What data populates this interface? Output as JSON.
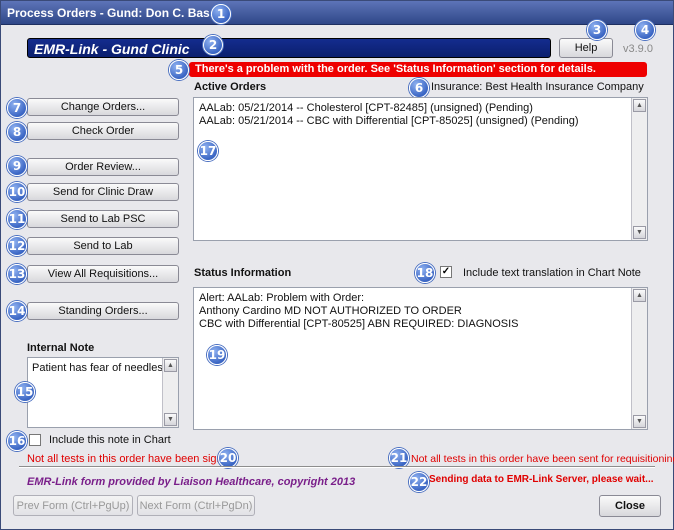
{
  "window": {
    "title": "Process Orders - Gund:  Don C. Bassett"
  },
  "header": {
    "banner": "EMR-Link - Gund Clinic",
    "help_label": "Help",
    "version": "v3.9.0",
    "error_message": "There's a problem with the order. See 'Status Information' section for details."
  },
  "badges": [
    "1",
    "2",
    "3",
    "4",
    "5",
    "6",
    "7",
    "8",
    "9",
    "10",
    "11",
    "12",
    "13",
    "14",
    "15",
    "16",
    "17",
    "18",
    "19",
    "20",
    "21",
    "22"
  ],
  "sidebar": {
    "buttons": [
      {
        "label": "Change Orders..."
      },
      {
        "label": "Check Order"
      },
      {
        "label": "Order Review..."
      },
      {
        "label": "Send for Clinic Draw"
      },
      {
        "label": "Send to Lab PSC"
      },
      {
        "label": "Send to Lab"
      },
      {
        "label": "View All Requisitions..."
      },
      {
        "label": "Standing Orders..."
      }
    ],
    "internal_note": {
      "heading": "Internal Note",
      "value": "Patient has fear of needles",
      "include_label": "Include this note in Chart",
      "include_checked": false
    }
  },
  "active_orders": {
    "heading": "Active Orders",
    "insurance": "Insurance: Best Health Insurance Company",
    "items": [
      "AALab: 05/21/2014 -- Cholesterol [CPT-82485]  (unsigned)   (Pending)",
      "AALab: 05/21/2014 -- CBC with Differential [CPT-85025]  (unsigned)   (Pending)"
    ]
  },
  "status_info": {
    "heading": "Status Information",
    "translate_label": "Include text translation in Chart Note",
    "translate_checked": true,
    "lines": [
      "Alert: AALab: Problem with Order:",
      "Anthony Cardino MD NOT AUTHORIZED TO ORDER",
      "CBC with Differential [CPT-80525] ABN REQUIRED: DIAGNOSIS"
    ]
  },
  "warnings": {
    "not_signed": "Not all tests in this order have been signed",
    "not_sent": "Not all tests in this order have been sent for requisitioning"
  },
  "footer": {
    "credit": "EMR-Link form provided by Liaison Healthcare, copyright 2013",
    "sending": "Sending data to EMR-Link Server, please wait...",
    "prev_label": "Prev Form (Ctrl+PgUp)",
    "next_label": "Next Form (Ctrl+PgDn)",
    "close_label": "Close"
  },
  "colors": {
    "title_bar": "#3b53a0",
    "banner": "#0f2585",
    "error": "#ee0000",
    "warning_text": "#e00000",
    "credit_text": "#7a1f8a",
    "badge": "#3b66c4"
  },
  "icons": [
    "check-icon",
    "scroll-up-arrow-icon",
    "scroll-down-arrow-icon",
    "number-badge-icon"
  ]
}
